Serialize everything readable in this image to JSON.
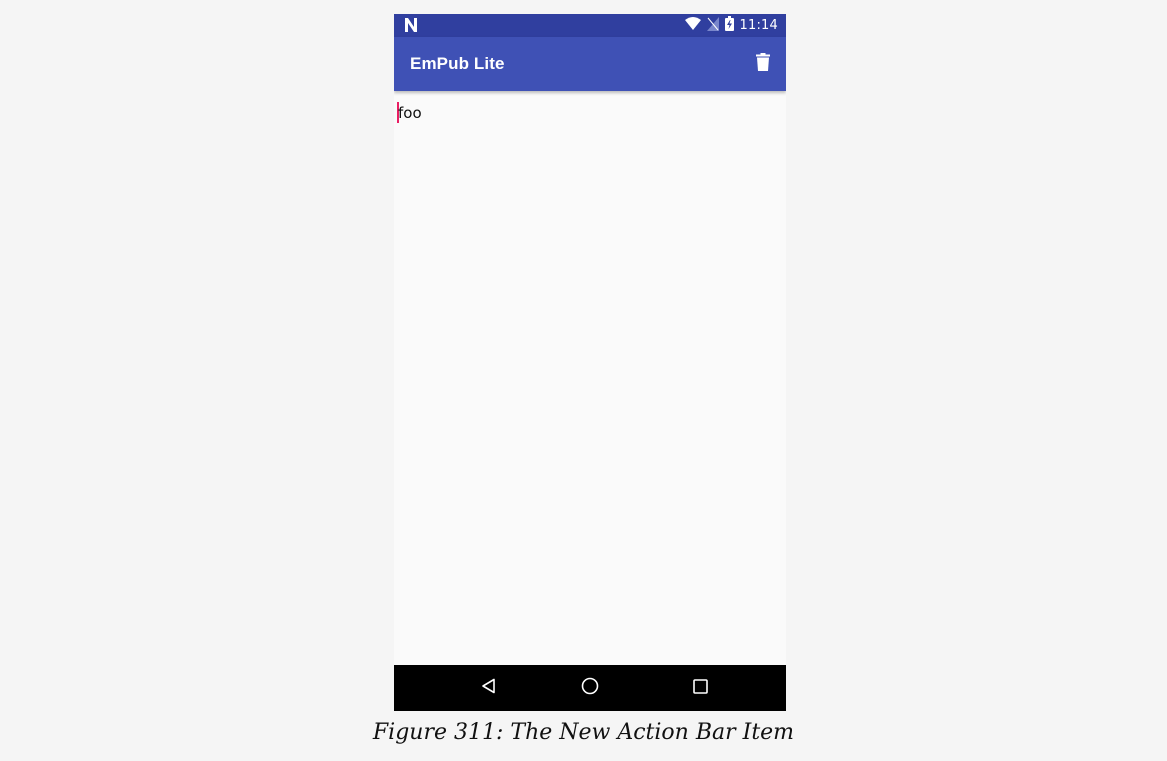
{
  "status_bar": {
    "time": "11:14",
    "icons": [
      "notification-n-icon",
      "wifi-icon",
      "no-sim-icon",
      "battery-charging-icon"
    ]
  },
  "app_bar": {
    "title": "EmPub Lite",
    "action_icon": "trash-icon"
  },
  "editor": {
    "value": "foo"
  },
  "nav_bar": {
    "icons": [
      "back-icon",
      "home-icon",
      "recents-icon"
    ]
  },
  "caption": "Figure 311: The New Action Bar Item",
  "colors": {
    "status_bar": "#303f9f",
    "primary": "#3f51b5",
    "accent": "#e91e63",
    "background": "#fafafa",
    "nav_bar": "#000000"
  }
}
